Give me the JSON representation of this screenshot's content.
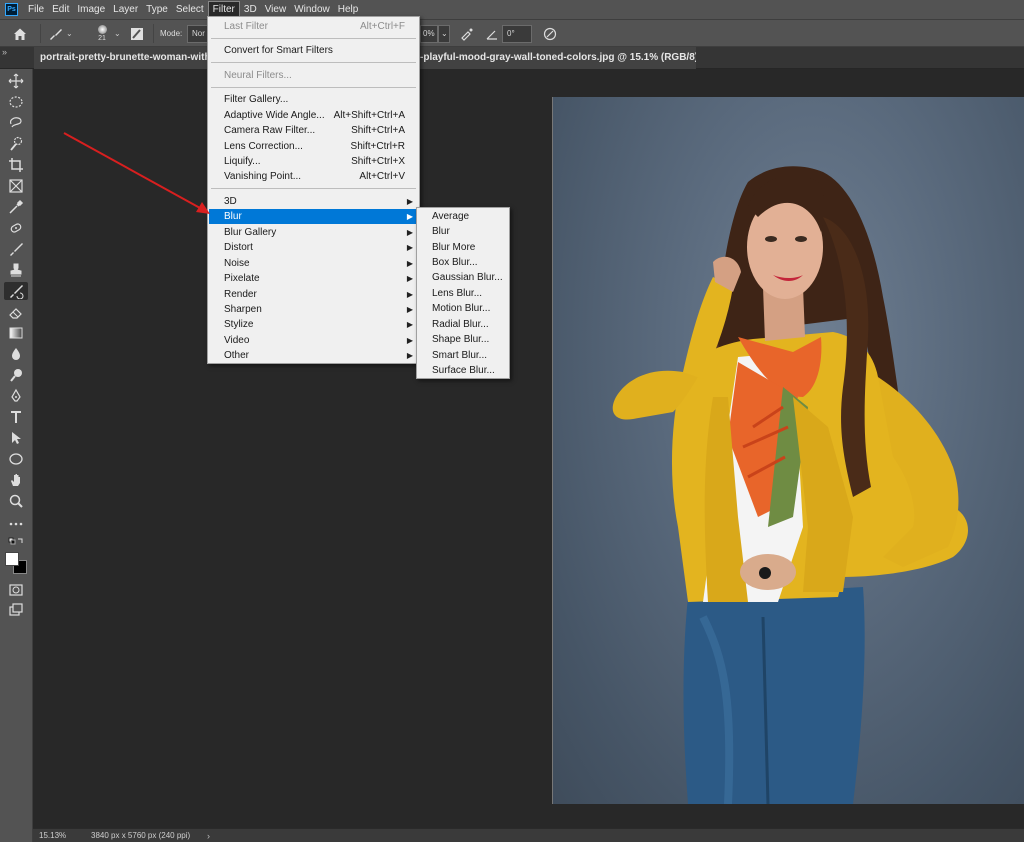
{
  "app": {
    "logo_text": "Ps",
    "menu": [
      "File",
      "Edit",
      "Image",
      "Layer",
      "Type",
      "Select",
      "Filter",
      "3D",
      "View",
      "Window",
      "Help"
    ],
    "active_menu": "Filter"
  },
  "options_bar": {
    "brush_size": "21",
    "mode_label": "Mode:",
    "mode_value": "Nor",
    "opacity_value": "0%",
    "angle_value": "0°"
  },
  "tabs": [
    {
      "label": "portrait-pretty-brunette-woman-with-lo"
    },
    {
      "label": "-playful-mood-gray-wall-toned-colors.jpg @ 15.1% (RGB/8) *"
    }
  ],
  "filter_menu": {
    "items": [
      {
        "label": "Last Filter",
        "shortcut": "Alt+Ctrl+F",
        "disabled": true
      },
      {
        "label": "Convert for Smart Filters",
        "shortcut": ""
      },
      {
        "label": "Neural Filters...",
        "shortcut": "",
        "disabled": true
      },
      {
        "label": "Filter Gallery...",
        "shortcut": ""
      },
      {
        "label": "Adaptive Wide Angle...",
        "shortcut": "Alt+Shift+Ctrl+A"
      },
      {
        "label": "Camera Raw Filter...",
        "shortcut": "Shift+Ctrl+A"
      },
      {
        "label": "Lens Correction...",
        "shortcut": "Shift+Ctrl+R"
      },
      {
        "label": "Liquify...",
        "shortcut": "Shift+Ctrl+X"
      },
      {
        "label": "Vanishing Point...",
        "shortcut": "Alt+Ctrl+V"
      },
      {
        "label": "3D",
        "submenu": true
      },
      {
        "label": "Blur",
        "submenu": true,
        "highlighted": true
      },
      {
        "label": "Blur Gallery",
        "submenu": true
      },
      {
        "label": "Distort",
        "submenu": true
      },
      {
        "label": "Noise",
        "submenu": true
      },
      {
        "label": "Pixelate",
        "submenu": true
      },
      {
        "label": "Render",
        "submenu": true
      },
      {
        "label": "Sharpen",
        "submenu": true
      },
      {
        "label": "Stylize",
        "submenu": true
      },
      {
        "label": "Video",
        "submenu": true
      },
      {
        "label": "Other",
        "submenu": true
      }
    ]
  },
  "blur_submenu": {
    "items": [
      "Average",
      "Blur",
      "Blur More",
      "Box Blur...",
      "Gaussian Blur...",
      "Lens Blur...",
      "Motion Blur...",
      "Radial Blur...",
      "Shape Blur...",
      "Smart Blur...",
      "Surface Blur..."
    ]
  },
  "status_bar": {
    "zoom": "15.13%",
    "doc_info": "3840 px x 5760 px (240 ppi)",
    "chevron": "›"
  },
  "colors": {
    "menu_highlight": "#0078d7",
    "annotation_arrow": "#d81f1f",
    "ui_panel": "#535353",
    "canvas_bg": "#282828"
  }
}
